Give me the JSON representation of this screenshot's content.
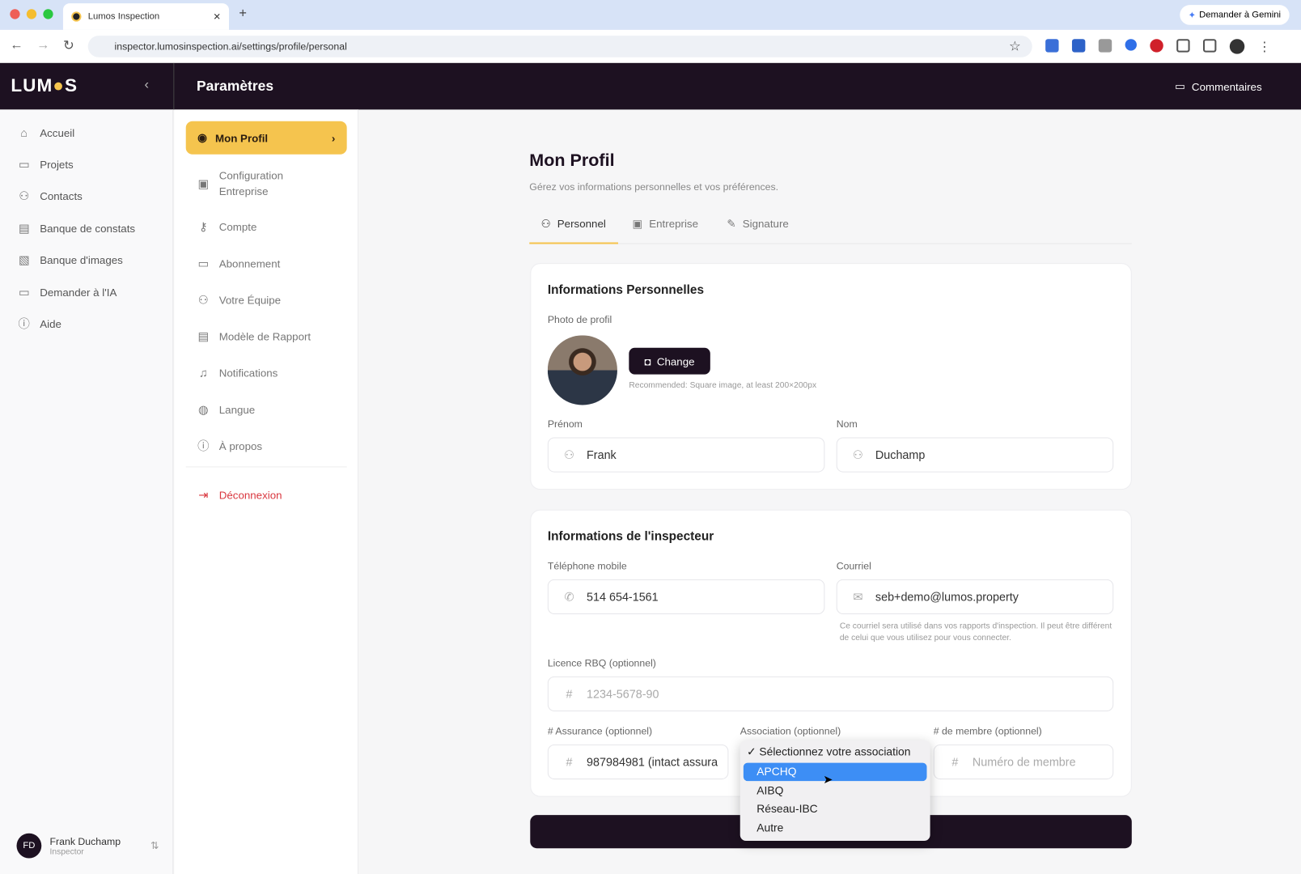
{
  "browser": {
    "tab_title": "Lumos Inspection",
    "url": "inspector.lumosinspection.ai/settings/profile/personal",
    "gemini": "Demander à Gemini"
  },
  "app": {
    "logo": "LUMOS",
    "header_title": "Paramètres",
    "feedback": "Commentaires"
  },
  "sidebar": {
    "items": [
      {
        "label": "Accueil",
        "icon": "home-icon"
      },
      {
        "label": "Projets",
        "icon": "folder-icon"
      },
      {
        "label": "Contacts",
        "icon": "user-icon"
      },
      {
        "label": "Banque de constats",
        "icon": "document-icon"
      },
      {
        "label": "Banque d'images",
        "icon": "image-icon"
      },
      {
        "label": "Demander à l'IA",
        "icon": "chat-icon"
      },
      {
        "label": "Aide",
        "icon": "help-icon"
      }
    ],
    "user": {
      "initials": "FD",
      "name": "Frank Duchamp",
      "role": "Inspector"
    }
  },
  "settings_nav": {
    "items": [
      {
        "label": "Mon Profil",
        "active": true
      },
      {
        "label": "Configuration Entreprise"
      },
      {
        "label": "Compte"
      },
      {
        "label": "Abonnement"
      },
      {
        "label": "Votre Équipe"
      },
      {
        "label": "Modèle de Rapport"
      },
      {
        "label": "Notifications"
      },
      {
        "label": "Langue"
      },
      {
        "label": "À propos"
      }
    ],
    "logout": "Déconnexion"
  },
  "page": {
    "title": "Mon Profil",
    "subtitle": "Gérez vos informations personnelles et vos préférences.",
    "tabs": [
      {
        "label": "Personnel",
        "active": true
      },
      {
        "label": "Entreprise"
      },
      {
        "label": "Signature"
      }
    ]
  },
  "personal": {
    "heading": "Informations Personnelles",
    "photo_label": "Photo de profil",
    "change": "Change",
    "photo_hint": "Recommended: Square image, at least 200×200px",
    "first_name_label": "Prénom",
    "first_name": "Frank",
    "last_name_label": "Nom",
    "last_name": "Duchamp"
  },
  "inspector": {
    "heading": "Informations de l'inspecteur",
    "phone_label": "Téléphone mobile",
    "phone": "514 654-1561",
    "email_label": "Courriel",
    "email": "seb+demo@lumos.property",
    "email_hint": "Ce courriel sera utilisé dans vos rapports d'inspection. Il peut être différent de celui que vous utilisez pour vous connecter.",
    "rbq_label": "Licence RBQ (optionnel)",
    "rbq_placeholder": "1234-5678-90",
    "insurance_label": "# Assurance (optionnel)",
    "insurance": "987984981 (intact assura",
    "association_label": "Association (optionnel)",
    "member_label": "# de membre (optionnel)",
    "member_placeholder": "Numéro de membre",
    "association_options": [
      {
        "label": "Sélectionnez votre association",
        "checked": true
      },
      {
        "label": "APCHQ",
        "highlighted": true
      },
      {
        "label": "AIBQ"
      },
      {
        "label": "Réseau-IBC"
      },
      {
        "label": "Autre"
      }
    ]
  },
  "colors": {
    "accent": "#f5c44e",
    "dark": "#1d1121",
    "highlight": "#3d8ef5",
    "logout": "#d9363e"
  }
}
